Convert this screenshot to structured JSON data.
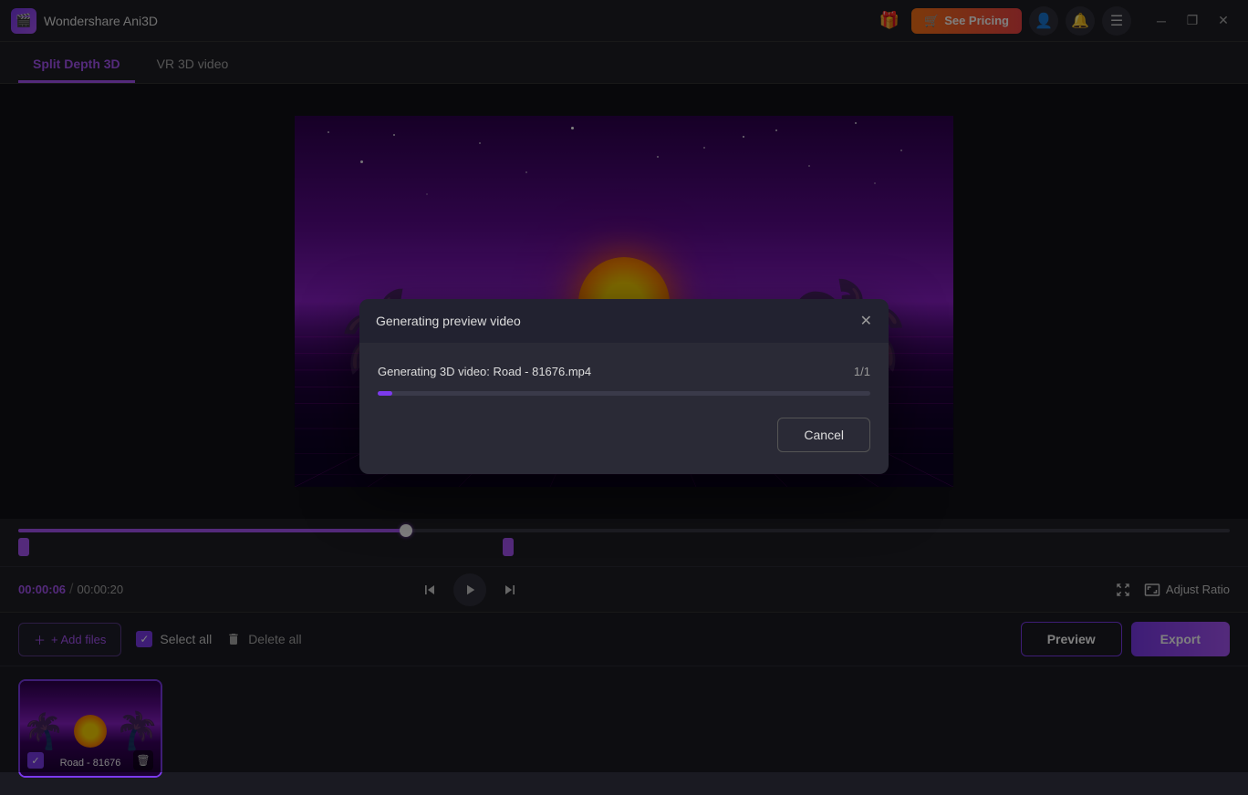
{
  "app": {
    "title": "Wondershare Ani3D",
    "icon": "🎬"
  },
  "titlebar": {
    "gift_icon": "🎁",
    "see_pricing_label": "See Pricing",
    "cart_icon": "🛒",
    "user_icon": "👤",
    "notification_icon": "🔔",
    "menu_icon": "☰",
    "minimize_icon": "─",
    "restore_icon": "❐",
    "close_icon": "✕"
  },
  "tabs": [
    {
      "id": "split-depth",
      "label": "Split Depth 3D",
      "active": true
    },
    {
      "id": "vr-3d",
      "label": "VR 3D video",
      "active": false
    }
  ],
  "timeline": {
    "current_time": "00:00:06",
    "total_time": "00:00:20",
    "progress_pct": 32
  },
  "controls": {
    "skip_back_icon": "⏮",
    "play_icon": "▶",
    "skip_forward_icon": "⏭",
    "fit_icon": "⛶",
    "adjust_ratio_icon": "⛶",
    "adjust_ratio_label": "Adjust Ratio"
  },
  "toolbar": {
    "add_files_label": "+ Add files",
    "select_all_label": "Select all",
    "delete_all_label": "Delete all",
    "preview_label": "Preview",
    "export_label": "Export"
  },
  "file_items": [
    {
      "id": "road-81676",
      "label": "Road - 81676",
      "selected": true
    }
  ],
  "modal": {
    "title": "Generating preview video",
    "file_name": "Generating 3D video: Road - 81676.mp4",
    "progress_count": "1/1",
    "progress_pct": 3,
    "cancel_label": "Cancel"
  }
}
